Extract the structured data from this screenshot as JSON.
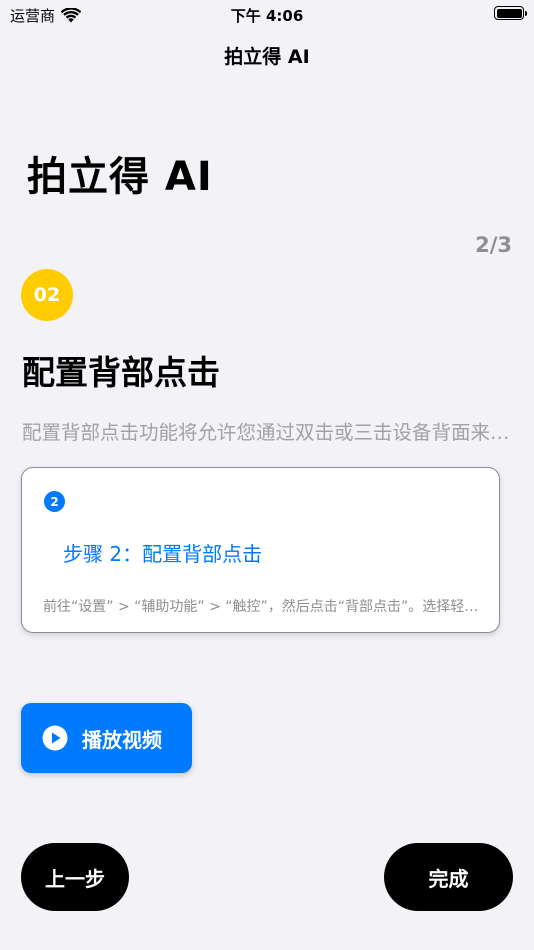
{
  "status_bar": {
    "carrier": "运营商",
    "time": "下午 4:06",
    "battery_level": 1.0
  },
  "nav": {
    "title": "拍立得 AI"
  },
  "page": {
    "large_title": "拍立得 AI",
    "step_counter": "2/3",
    "step_badge": "02",
    "step_heading": "配置背部点击",
    "step_description": "配置背部点击功能将允许您通过双击或三击设备背面来触发快捷指令。"
  },
  "card": {
    "number": "2",
    "title": "步骤 2：配置背部点击",
    "body": "前往“设置” > “辅助功能” > “触控”，然后点击“背部点击”。选择轻点两下或轻点三下。"
  },
  "buttons": {
    "play_video": "播放视频",
    "previous": "上一步",
    "done": "完成"
  },
  "colors": {
    "accent": "#007AFF",
    "badge": "#FFCC00",
    "background": "#F2F2F7"
  },
  "icons": {
    "wifi": "wifi-icon",
    "battery": "battery-icon",
    "play": "play-circle-icon"
  }
}
